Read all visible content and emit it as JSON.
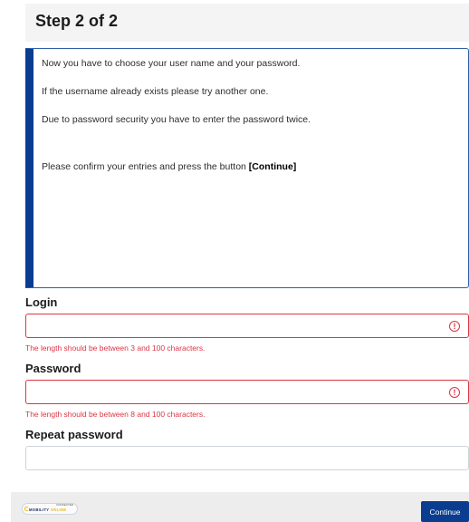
{
  "header": {
    "title": "Step 2 of 2"
  },
  "info": {
    "line1": "Now you have to choose your user name and your password.",
    "line2": "If the username already exists please try another one.",
    "line3": "Due to password security you have to enter the password twice.",
    "line4_prefix": "Please confirm your entries and press the button ",
    "line4_button_ref": "[Continue]"
  },
  "form": {
    "login": {
      "label": "Login",
      "value": "",
      "error": "The length should be between 3 and 100 characters.",
      "error_icon": "exclamation-circle-icon"
    },
    "password": {
      "label": "Password",
      "value": "",
      "error": "The length should be between 8 and 100 characters.",
      "error_icon": "exclamation-circle-icon"
    },
    "repeat_password": {
      "label": "Repeat password",
      "value": ""
    }
  },
  "footer": {
    "logo_small_text": "CONNECTED",
    "logo_main_text": "MOBILITY",
    "logo_accent_text": "ONLINE",
    "continue_label": "Continue"
  },
  "colors": {
    "primary": "#0a3d8f",
    "error": "#dc3545",
    "header_bg": "#f4f4f4",
    "footer_bg": "#ededed",
    "logo_accent": "#f2b71b"
  }
}
